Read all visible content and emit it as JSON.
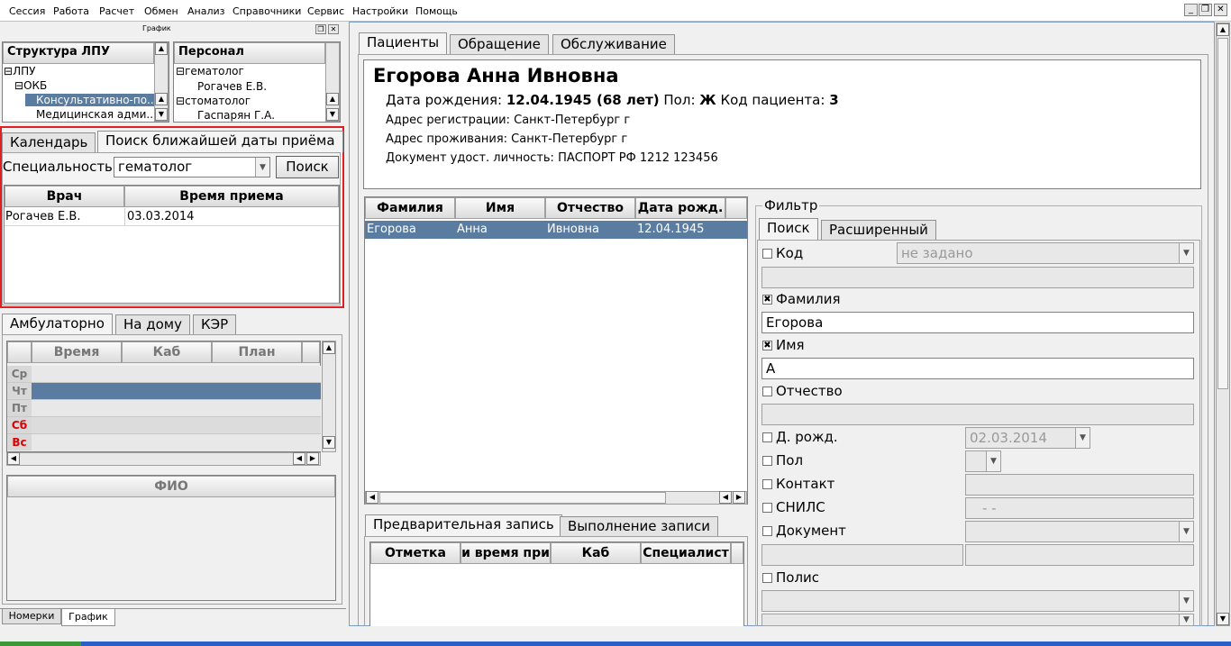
{
  "menu": [
    "Сессия",
    "Работа",
    "Расчет",
    "Обмен",
    "Анализ",
    "Справочники",
    "Сервис",
    "Настройки",
    "Помощь"
  ],
  "left_panel": {
    "title": "График",
    "structure": {
      "header": "Структура ЛПУ",
      "items": [
        "ЛПУ",
        "ОКБ",
        "Консультативно-по...",
        "Медицинская адми..."
      ]
    },
    "personnel": {
      "header": "Персонал",
      "items": [
        "гематолог",
        "Рогачев Е.В.",
        "стоматолог",
        "Гаспарян Г.А."
      ]
    },
    "search_tabs": [
      "Календарь",
      "Поиск ближайшей даты приёма"
    ],
    "specialty_label": "Специальность",
    "specialty_value": "гематолог",
    "search_button": "Поиск",
    "result_cols": [
      "Врач",
      "Время приема"
    ],
    "result_rows": [
      [
        "Рогачев Е.В.",
        "03.03.2014"
      ]
    ],
    "sched_tabs": [
      "Амбулаторно",
      "На дому",
      "КЭР"
    ],
    "sched_cols": [
      "Время",
      "Каб",
      "План"
    ],
    "days": [
      "Ср",
      "Чт",
      "Пт",
      "Сб",
      "Вс"
    ],
    "fio_header": "ФИО",
    "bottom_tabs": [
      "Номерки",
      "График"
    ]
  },
  "main": {
    "tabs": [
      "Пациенты",
      "Обращение",
      "Обслуживание"
    ],
    "patient": {
      "name": "Егорова Анна Ивновна",
      "dob_label": "Дата рождения:",
      "dob": "12.04.1945 (68 лет)",
      "sex_label": "Пол:",
      "sex": "Ж",
      "code_label": "Код пациента:",
      "code": "3",
      "reg": "Адрес регистрации: Санкт-Петербург г",
      "live": "Адрес проживания: Санкт-Петербург г",
      "doc": "Документ удост. личность: ПАСПОРТ РФ 1212 123456"
    },
    "grid_cols": [
      "Фамилия",
      "Имя",
      "Отчество",
      "Дата рожд."
    ],
    "grid_rows": [
      [
        "Егорова",
        "Анна",
        "Ивновна",
        "12.04.1945"
      ]
    ],
    "record_tabs": [
      "Предварительная запись",
      "Выполнение записи"
    ],
    "record_cols": [
      "Отметка",
      "и время при",
      "Каб",
      "Специалист"
    ]
  },
  "filter": {
    "title": "Фильтр",
    "tabs": [
      "Поиск",
      "Расширенный"
    ],
    "code_label": "Код",
    "code_placeholder": "не задано",
    "surname_label": "Фамилия",
    "surname_value": "Егорова",
    "name_label": "Имя",
    "name_value": "А",
    "patronymic_label": "Отчество",
    "dob_label": "Д. рожд.",
    "dob_value": "02.03.2014",
    "sex_label": "Пол",
    "contact_label": "Контакт",
    "snils_label": "СНИЛС",
    "snils_mask": "-   -",
    "document_label": "Документ",
    "policy_label": "Полис"
  },
  "colors": {
    "selection": "#5a7ca0",
    "highlight_border": "#e02020",
    "weekend": "#e00000"
  }
}
